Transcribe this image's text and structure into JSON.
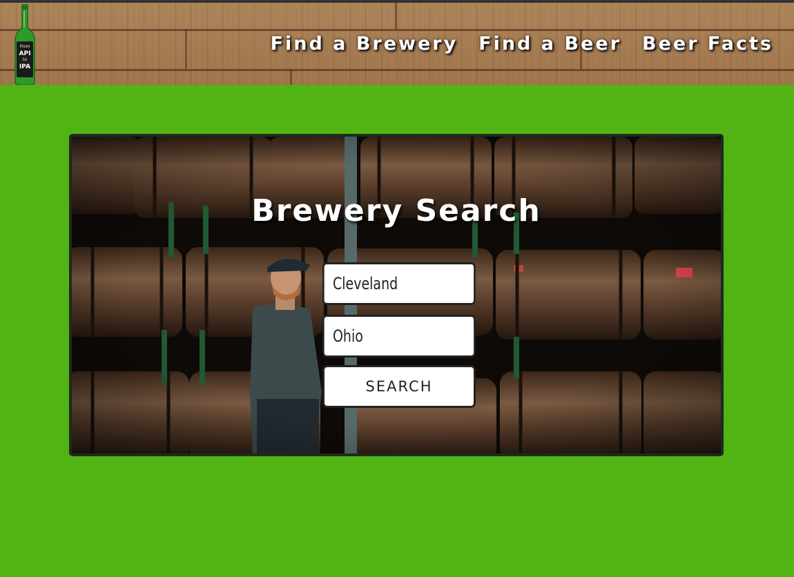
{
  "header": {
    "logo": {
      "text_lines": [
        "From",
        "API",
        "to",
        "IPA"
      ],
      "icon": "beer-bottle-icon"
    },
    "nav": [
      {
        "label": "Find a Brewery"
      },
      {
        "label": "Find a Beer"
      },
      {
        "label": "Beer Facts"
      }
    ]
  },
  "hero": {
    "title": "Brewery Search",
    "city_field": {
      "value": "Cleveland"
    },
    "state_field": {
      "value": "Ohio"
    },
    "search_button": {
      "label": "SEARCH"
    }
  },
  "colors": {
    "page_background": "#52b314",
    "header_wood": "#a77b4f",
    "hero_border": "#1e2a1e",
    "nav_text": "#ffffff"
  }
}
